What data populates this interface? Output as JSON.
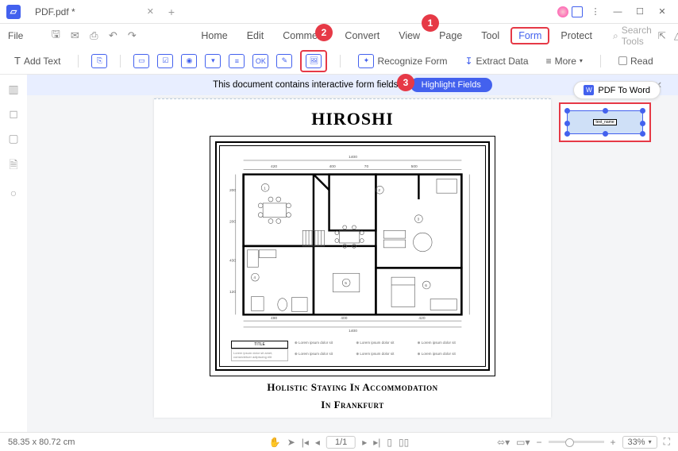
{
  "titlebar": {
    "doc_name": "PDF.pdf *"
  },
  "menu": {
    "file": "File",
    "tabs": [
      "Home",
      "Edit",
      "Comment",
      "Convert",
      "View",
      "Page",
      "Tool",
      "Form",
      "Protect"
    ],
    "active_index": 7,
    "search_ph": "Search Tools"
  },
  "toolbar": {
    "add_text": "Add Text",
    "recognize": "Recognize Form",
    "extract": "Extract Data",
    "more": "More",
    "read": "Read"
  },
  "callouts": {
    "one": "1",
    "two": "2",
    "three": "3"
  },
  "banner": {
    "msg": "This document contains interactive form fields.",
    "btn": "Highlight Fields"
  },
  "pdf2word": "PDF To Word",
  "doc": {
    "title": "HIROSHI",
    "field_label": "text_name",
    "subtitle1": "Holistic Staying In Accommodation",
    "subtitle2": "In Frankfurt",
    "legend_title": "TITLE",
    "legend_sub": "Lorem ipsum dolor sit amet, consectetuer adipiscing elit",
    "legend_items": [
      "Lorem ipsum dolor sit",
      "Lorem ipsum dolor sit",
      "Lorem ipsum dolor sit",
      "Lorem ipsum dolor sit",
      "Lorem ipsum dolor sit",
      "Lorem ipsum dolor sit"
    ],
    "rooms": [
      "1",
      "2",
      "3",
      "4",
      "5",
      "6"
    ],
    "dims": {
      "top": "1400",
      "a": "420",
      "b": "400",
      "c": "70",
      "d": "500",
      "e": "200",
      "f": "200",
      "g": "430",
      "h": "120",
      "i": "490",
      "j": "400",
      "k": "420",
      "bot": "1400"
    }
  },
  "status": {
    "coords": "58.35 x 80.72 cm",
    "page": "1/1",
    "zoom": "33%"
  }
}
